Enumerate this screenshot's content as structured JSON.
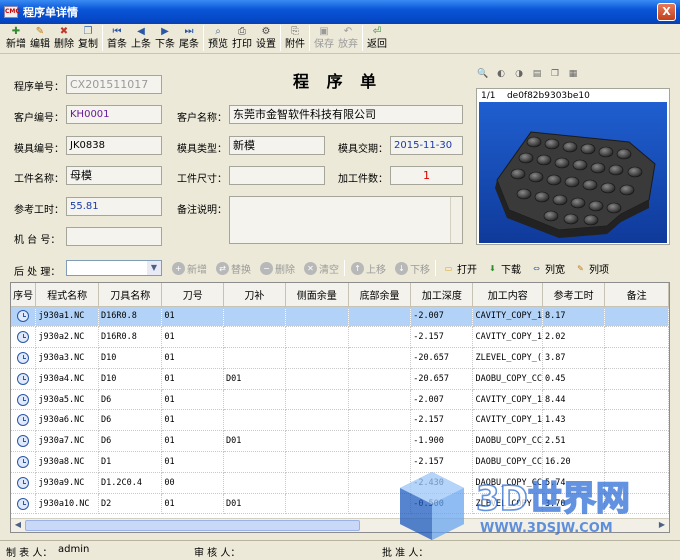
{
  "window": {
    "title": "程序单详情",
    "app_icon_text": "CMC",
    "close_label": "X"
  },
  "toolbar": [
    {
      "label": "新增",
      "icon": "new-icon",
      "color": "#2e8b2e",
      "glyph": "✚"
    },
    {
      "label": "编辑",
      "icon": "edit-icon",
      "color": "#c07a10",
      "glyph": "✎"
    },
    {
      "label": "删除",
      "icon": "delete-icon",
      "color": "#c0392b",
      "glyph": "✖"
    },
    {
      "label": "复制",
      "icon": "copy-icon",
      "color": "#3a6fb5",
      "glyph": "❐"
    },
    {
      "sep": true
    },
    {
      "label": "首条",
      "icon": "first-icon",
      "color": "#2a57a6",
      "glyph": "⏮"
    },
    {
      "label": "上条",
      "icon": "prev-icon",
      "color": "#2a57a6",
      "glyph": "◀"
    },
    {
      "label": "下条",
      "icon": "next-icon",
      "color": "#2a57a6",
      "glyph": "▶"
    },
    {
      "label": "尾条",
      "icon": "last-icon",
      "color": "#2a57a6",
      "glyph": "⏭"
    },
    {
      "sep": true
    },
    {
      "label": "预览",
      "icon": "preview-icon",
      "color": "#4a6a9a",
      "glyph": "⌕"
    },
    {
      "label": "打印",
      "icon": "print-icon",
      "color": "#4a4a4a",
      "glyph": "⎙"
    },
    {
      "label": "设置",
      "icon": "settings-icon",
      "color": "#4a4a4a",
      "glyph": "⚙"
    },
    {
      "sep": true
    },
    {
      "label": "附件",
      "icon": "attachment-icon",
      "color": "#6a6a6a",
      "glyph": "⎘"
    },
    {
      "sep": true
    },
    {
      "label": "保存",
      "icon": "save-icon",
      "color": "#9a9a9a",
      "glyph": "▣",
      "disabled": true
    },
    {
      "label": "放弃",
      "icon": "discard-icon",
      "color": "#9a9a9a",
      "glyph": "↶",
      "disabled": true
    },
    {
      "sep": true
    },
    {
      "label": "返回",
      "icon": "return-icon",
      "color": "#2e8b2e",
      "glyph": "⏎"
    }
  ],
  "form": {
    "heading": "程 序 单",
    "program_no_label": "程序单号：",
    "program_no": "CX201511017",
    "customer_no_label": "客户编号：",
    "customer_no": "KH0001",
    "customer_name_label": "客户名称：",
    "customer_name": "东莞市金智软件科技有限公司",
    "mold_no_label": "模具编号：",
    "mold_no": "JK0838",
    "mold_type_label": "模具类型：",
    "mold_type": "新模",
    "mold_due_label": "模具交期：",
    "mold_due": "2015-11-30",
    "part_name_label": "工件名称：",
    "part_name": "母模",
    "part_size_label": "工件尺寸：",
    "part_size": "",
    "part_count_label": "加工件数：",
    "part_count": "1",
    "ref_hours_label": "参考工时：",
    "ref_hours": "55.81",
    "remark_label": "备注说明：",
    "remark": "",
    "machine_label": "机 台 号：",
    "machine": "",
    "post_label": "后 处 理：",
    "post": ""
  },
  "image": {
    "caption_index": "1/1",
    "caption_id": "de0f82b9303be10",
    "tools": [
      "zoom-in-icon",
      "rotate-left-icon",
      "rotate-right-icon",
      "save-image-icon",
      "copy-image-icon",
      "paste-image-icon"
    ]
  },
  "gridbar": [
    {
      "label": "新增",
      "icon": "grid-add-icon",
      "disabled": true
    },
    {
      "label": "替换",
      "icon": "grid-replace-icon",
      "disabled": true
    },
    {
      "label": "删除",
      "icon": "grid-delete-icon",
      "disabled": true
    },
    {
      "label": "清空",
      "icon": "grid-clear-icon",
      "disabled": true
    },
    {
      "sep": true
    },
    {
      "label": "上移",
      "icon": "move-up-icon",
      "disabled": true
    },
    {
      "label": "下移",
      "icon": "move-down-icon",
      "disabled": true
    },
    {
      "sep": true
    },
    {
      "label": "打开",
      "icon": "open-folder-icon"
    },
    {
      "label": "下载",
      "icon": "download-icon"
    },
    {
      "label": "列宽",
      "icon": "column-width-icon"
    },
    {
      "label": "列项",
      "icon": "column-items-icon"
    }
  ],
  "grid": {
    "columns": [
      "序号",
      "程式名称",
      "刀具名称",
      "刀号",
      "刀补",
      "侧面余量",
      "底部余量",
      "加工深度",
      "加工内容",
      "参考工时",
      "备注"
    ],
    "rows": [
      [
        "",
        "j930a1.NC",
        "D16R0.8",
        "01",
        "",
        "",
        "",
        "-2.007",
        "CAVITY_COPY_1",
        "8.17",
        ""
      ],
      [
        "",
        "j930a2.NC",
        "D16R0.8",
        "01",
        "",
        "",
        "",
        "-2.157",
        "CAVITY_COPY_1",
        "2.02",
        ""
      ],
      [
        "",
        "j930a3.NC",
        "D10",
        "01",
        "",
        "",
        "",
        "-20.657",
        "ZLEVEL_COPY_(",
        "3.87",
        ""
      ],
      [
        "",
        "j930a4.NC",
        "D10",
        "01",
        "D01",
        "",
        "",
        "-20.657",
        "DAOBU_COPY_CC",
        "0.45",
        ""
      ],
      [
        "",
        "j930a5.NC",
        "D6",
        "01",
        "",
        "",
        "",
        "-2.007",
        "CAVITY_COPY_1",
        "8.44",
        ""
      ],
      [
        "",
        "j930a6.NC",
        "D6",
        "01",
        "",
        "",
        "",
        "-2.157",
        "CAVITY_COPY_1",
        "1.43",
        ""
      ],
      [
        "",
        "j930a7.NC",
        "D6",
        "01",
        "D01",
        "",
        "",
        "-1.900",
        "DAOBU_COPY_CC",
        "2.51",
        ""
      ],
      [
        "",
        "j930a8.NC",
        "D1",
        "01",
        "",
        "",
        "",
        "-2.157",
        "DAOBU_COPY_CC",
        "16.20",
        ""
      ],
      [
        "",
        "j930a9.NC",
        "D1.2C0.4",
        "00",
        "",
        "",
        "",
        "-2.430",
        "DAOBU_COPY_CC",
        "5.74",
        ""
      ],
      [
        "",
        "j930a10.NC",
        "D2",
        "01",
        "D01",
        "",
        "",
        "-0.500",
        "ZLEVEL_COPY",
        "3.70",
        ""
      ]
    ],
    "selected_row": 0
  },
  "status": {
    "maker_label": "制 表 人：",
    "maker": "admin",
    "reviewer_label": "审 核 人：",
    "reviewer": "",
    "approver_label": "批 准 人：",
    "approver": ""
  },
  "watermark": {
    "brand": "3D世界网",
    "url": "WWW.3DSJW.COM",
    "color": "#2f6fd6"
  }
}
